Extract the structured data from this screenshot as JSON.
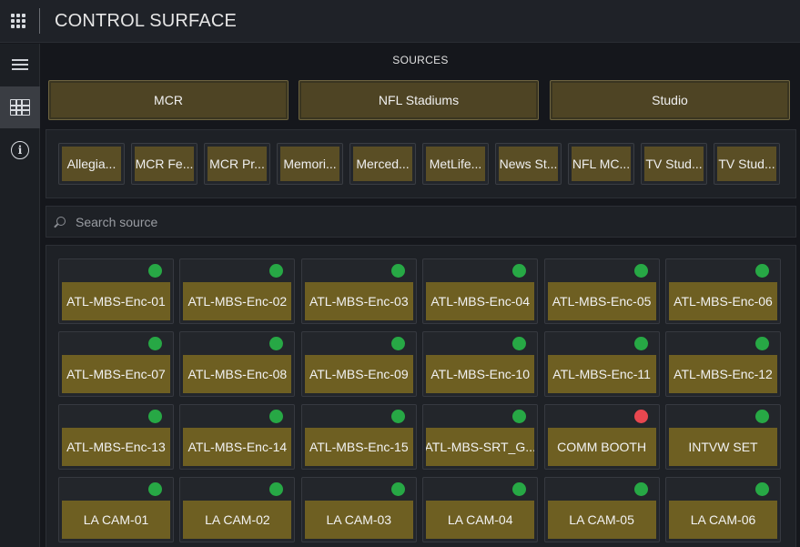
{
  "app": {
    "title": "CONTROL SURFACE"
  },
  "sidebar": {
    "items": [
      {
        "icon": "menu-icon",
        "active": false
      },
      {
        "icon": "source-grid-icon",
        "active": true
      },
      {
        "icon": "info-icon",
        "active": false
      }
    ],
    "info_glyph": "i"
  },
  "sources": {
    "section_label": "SOURCES",
    "categories": [
      "MCR",
      "NFL Stadiums",
      "Studio"
    ],
    "filters": [
      "Allegia...",
      "MCR Fe...",
      "MCR Pr...",
      "Memori...",
      "Merced...",
      "MetLife...",
      "News St...",
      "NFL MC...",
      "TV Stud...",
      "TV Stud..."
    ],
    "search": {
      "placeholder": "Search source",
      "value": ""
    },
    "tiles": [
      {
        "label": "ATL-MBS-Enc-01",
        "status": "online"
      },
      {
        "label": "ATL-MBS-Enc-02",
        "status": "online"
      },
      {
        "label": "ATL-MBS-Enc-03",
        "status": "online"
      },
      {
        "label": "ATL-MBS-Enc-04",
        "status": "online"
      },
      {
        "label": "ATL-MBS-Enc-05",
        "status": "online"
      },
      {
        "label": "ATL-MBS-Enc-06",
        "status": "online"
      },
      {
        "label": "ATL-MBS-Enc-07",
        "status": "online"
      },
      {
        "label": "ATL-MBS-Enc-08",
        "status": "online"
      },
      {
        "label": "ATL-MBS-Enc-09",
        "status": "online"
      },
      {
        "label": "ATL-MBS-Enc-10",
        "status": "online"
      },
      {
        "label": "ATL-MBS-Enc-11",
        "status": "online"
      },
      {
        "label": "ATL-MBS-Enc-12",
        "status": "online"
      },
      {
        "label": "ATL-MBS-Enc-13",
        "status": "online"
      },
      {
        "label": "ATL-MBS-Enc-14",
        "status": "online"
      },
      {
        "label": "ATL-MBS-Enc-15",
        "status": "online"
      },
      {
        "label": "ATL-MBS-SRT_G...",
        "status": "online"
      },
      {
        "label": "COMM BOOTH",
        "status": "offline"
      },
      {
        "label": "INTVW SET",
        "status": "online"
      },
      {
        "label": "LA CAM-01",
        "status": "online"
      },
      {
        "label": "LA CAM-02",
        "status": "online"
      },
      {
        "label": "LA CAM-03",
        "status": "online"
      },
      {
        "label": "LA CAM-04",
        "status": "online"
      },
      {
        "label": "LA CAM-05",
        "status": "online"
      },
      {
        "label": "LA CAM-06",
        "status": "online"
      }
    ]
  },
  "colors": {
    "status_online": "#27a845",
    "status_offline": "#e8474f",
    "tile_face": "#6e5f22",
    "category_face": "#4e4424"
  }
}
